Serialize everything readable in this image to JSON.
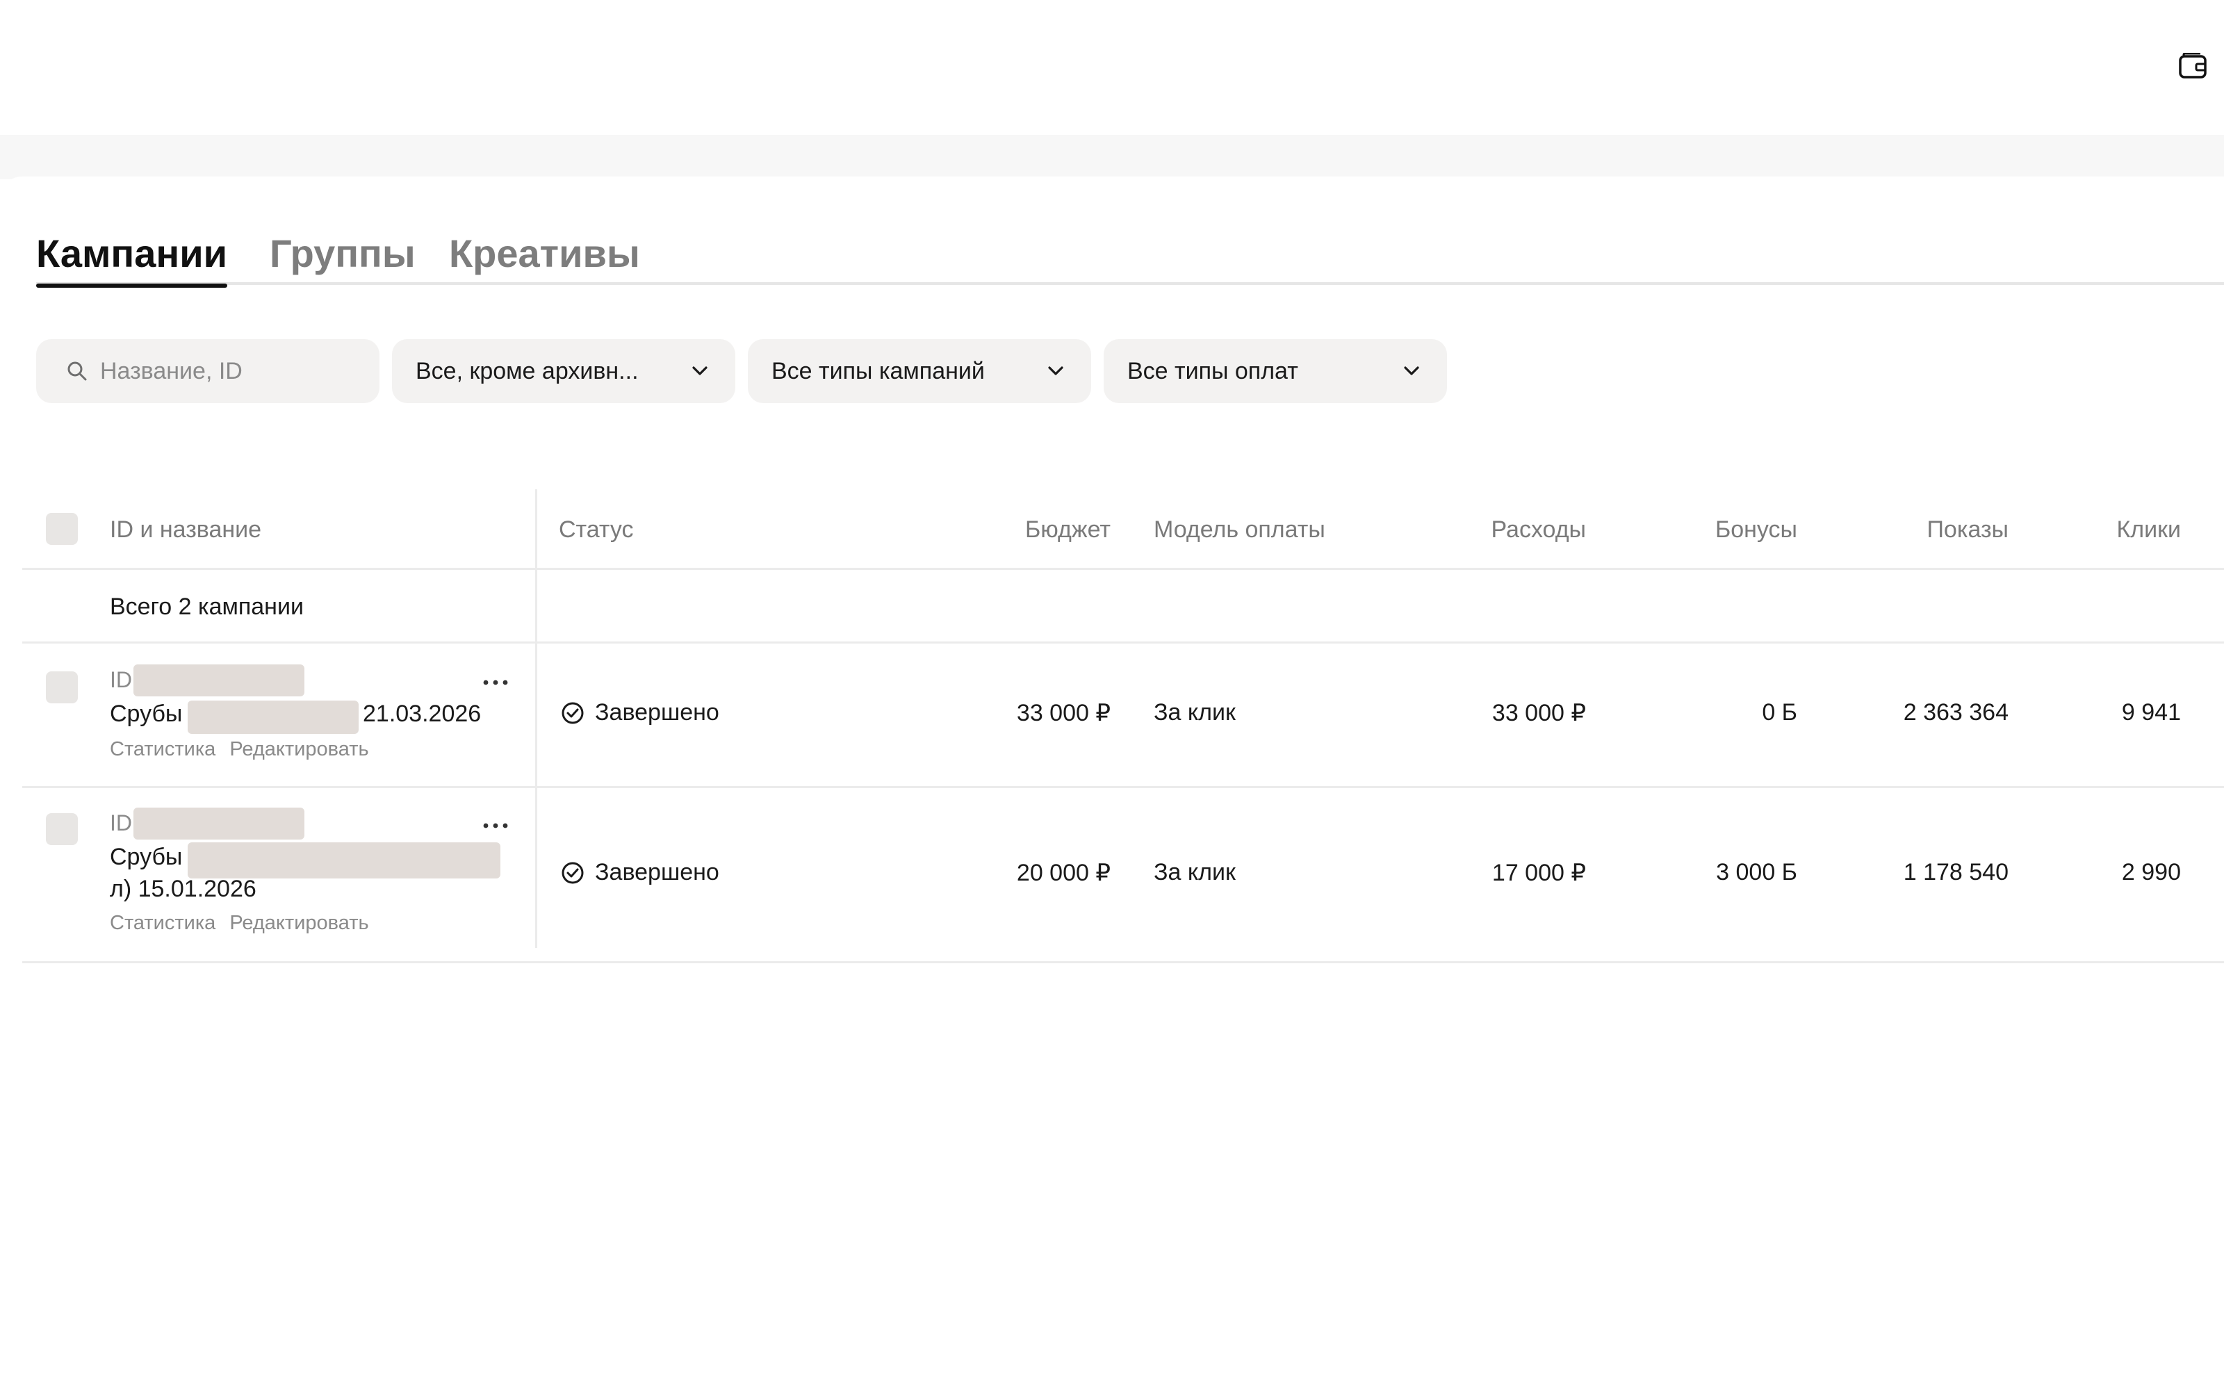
{
  "header": {
    "wallet_icon": "wallet-icon"
  },
  "tabs": [
    {
      "label": "Кампании",
      "active": true
    },
    {
      "label": "Группы",
      "active": false
    },
    {
      "label": "Креативы",
      "active": false
    }
  ],
  "filters": {
    "search_placeholder": "Название, ID",
    "status": "Все, кроме архивн...",
    "campaign_types": "Все типы кампаний",
    "payment_types": "Все типы оплат"
  },
  "table": {
    "columns": {
      "id_name": "ID и название",
      "status": "Статус",
      "budget": "Бюджет",
      "payment_model": "Модель оплаты",
      "expenses": "Расходы",
      "bonuses": "Бонусы",
      "impressions": "Показы",
      "clicks": "Клики"
    },
    "total_label": "Всего 2 кампании",
    "rows": [
      {
        "id_label": "ID",
        "name_start": "Срубы",
        "name_end": "21.03.2026",
        "name_line2": "",
        "links": [
          "Статистика",
          "Редактировать"
        ],
        "status": "Завершено",
        "budget": "33 000 ₽",
        "payment_model": "За клик",
        "expenses": "33 000 ₽",
        "bonuses": "0 Б",
        "impressions": "2 363 364",
        "clicks": "9 941"
      },
      {
        "id_label": "ID",
        "name_start": "Срубы",
        "name_end": "",
        "name_line2": "л) 15.01.2026",
        "links": [
          "Статистика",
          "Редактировать"
        ],
        "status": "Завершено",
        "budget": "20 000 ₽",
        "payment_model": "За клик",
        "expenses": "17 000 ₽",
        "bonuses": "3 000 Б",
        "impressions": "1 178 540",
        "clicks": "2 990"
      }
    ]
  }
}
